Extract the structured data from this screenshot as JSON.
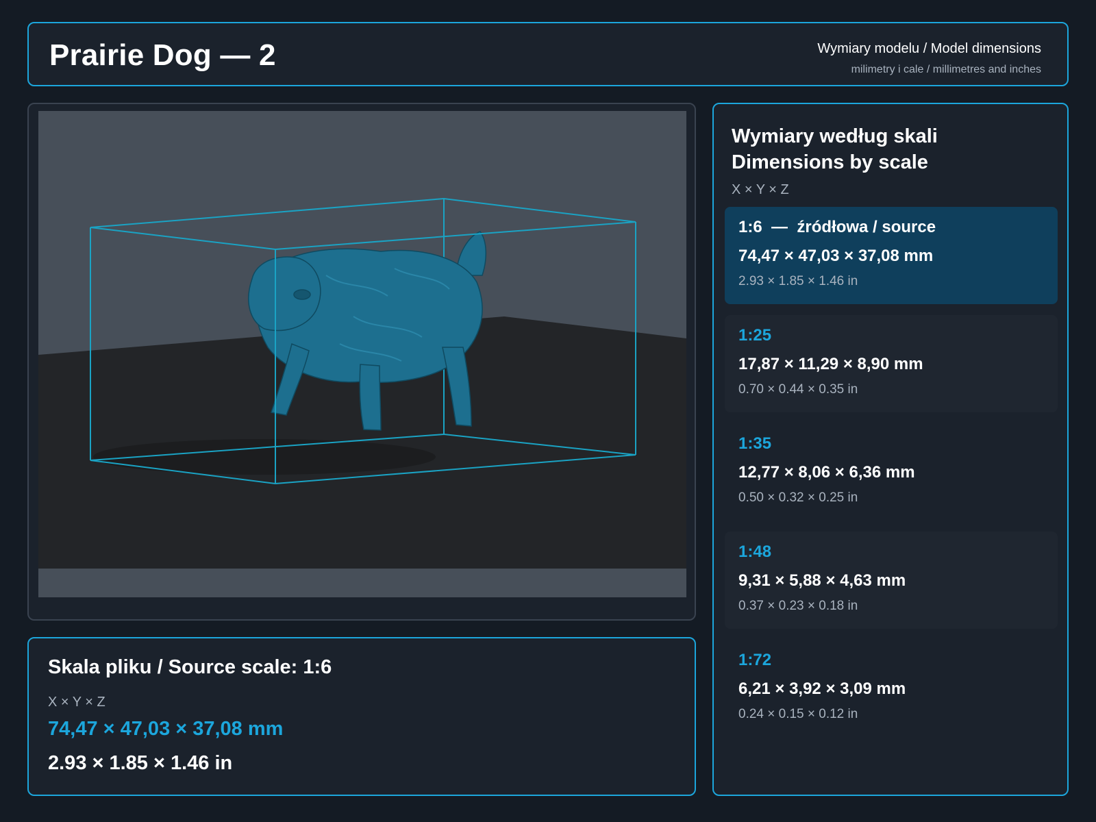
{
  "header": {
    "title": "Prairie Dog — 2",
    "subtitle": "Wymiary modelu / Model dimensions",
    "units_note": "milimetry i cale / millimetres and inches"
  },
  "viewport": {
    "model_color": "#1d6f8f",
    "bbox_color": "#1aa3c4"
  },
  "source": {
    "title": "Skala pliku / Source scale: 1:6",
    "axes": "X × Y × Z",
    "mm": "74,47 × 47,03 × 37,08 mm",
    "inches": "2.93 × 1.85 × 1.46 in"
  },
  "scales": {
    "heading_line1": "Wymiary według skali",
    "heading_line2": "Dimensions by scale",
    "axes": "X × Y × Z",
    "items": [
      {
        "label": "1:6  —  źródłowa / source",
        "mm": "74,47 × 47,03 × 37,08 mm",
        "inches": "2.93 × 1.85 × 1.46 in"
      },
      {
        "label": "1:25",
        "mm": "17,87 × 11,29 × 8,90 mm",
        "inches": "0.70 × 0.44 × 0.35 in"
      },
      {
        "label": "1:35",
        "mm": "12,77 × 8,06 × 6,36 mm",
        "inches": "0.50 × 0.32 × 0.25 in"
      },
      {
        "label": "1:48",
        "mm": "9,31 × 5,88 × 4,63 mm",
        "inches": "0.37 × 0.23 × 0.18 in"
      },
      {
        "label": "1:72",
        "mm": "6,21 × 3,92 × 3,09 mm",
        "inches": "0.24 × 0.15 × 0.12 in"
      }
    ]
  },
  "colors": {
    "accent": "#1ca6dc",
    "active_card": "#0f3f5c",
    "background": "#141b24"
  }
}
